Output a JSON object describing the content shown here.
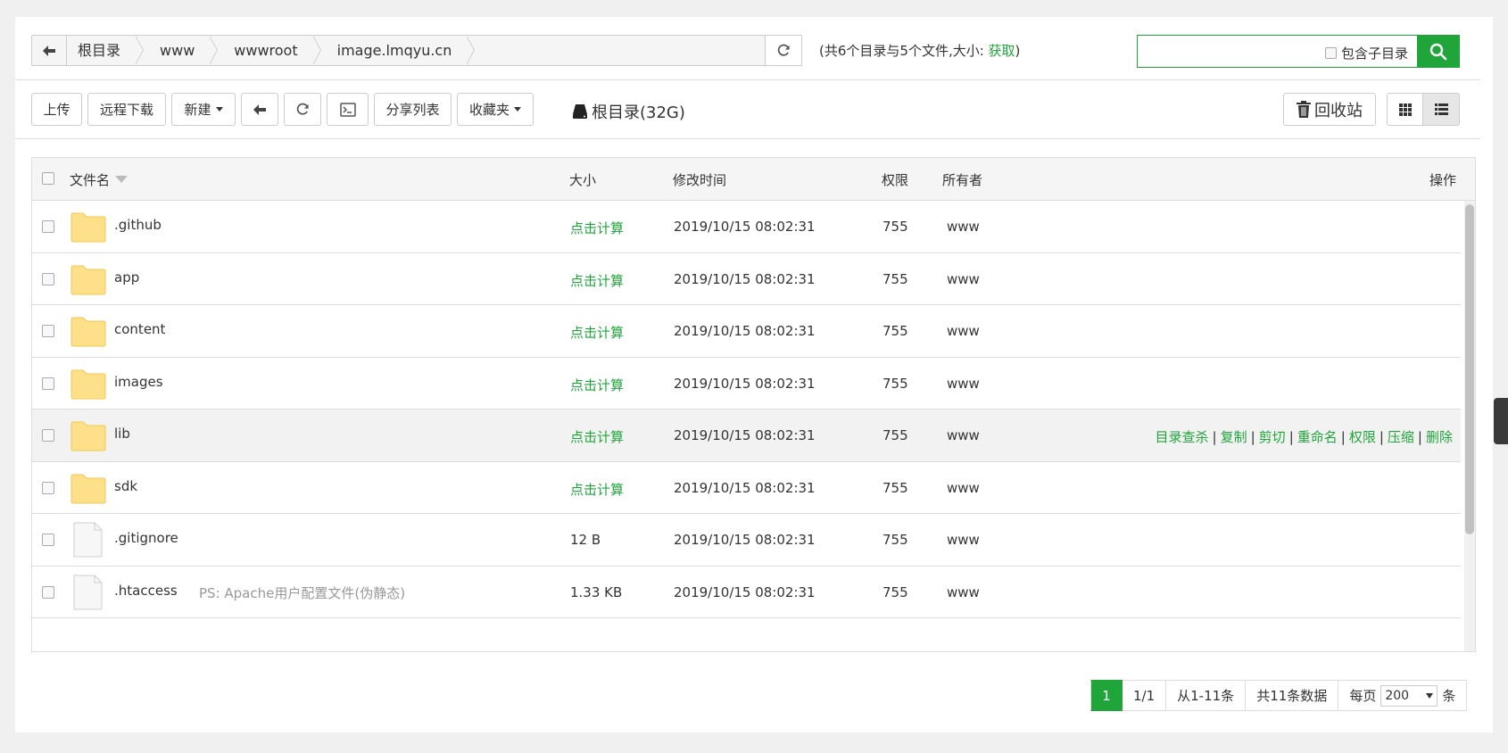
{
  "breadcrumb": [
    "根目录",
    "www",
    "wwwroot",
    "image.lmqyu.cn"
  ],
  "dir_info": {
    "prefix": "(共6个目录与5个文件,大小: ",
    "link": "获取",
    "suffix": ")"
  },
  "search": {
    "value": "",
    "subdir_label": "包含子目录"
  },
  "toolbar": {
    "upload": "上传",
    "remote_download": "远程下载",
    "new": "新建",
    "share_list": "分享列表",
    "favorites": "收藏夹",
    "disk_label": "根目录(32G)",
    "recycle": "回收站"
  },
  "table": {
    "headers": {
      "name": "文件名",
      "size": "大小",
      "mtime": "修改时间",
      "perm": "权限",
      "owner": "所有者",
      "ops": "操作"
    },
    "rows": [
      {
        "type": "folder",
        "name": ".github",
        "size": "点击计算",
        "mtime": "2019/10/15 08:02:31",
        "perm": "755",
        "owner": "www"
      },
      {
        "type": "folder",
        "name": "app",
        "size": "点击计算",
        "mtime": "2019/10/15 08:02:31",
        "perm": "755",
        "owner": "www"
      },
      {
        "type": "folder",
        "name": "content",
        "size": "点击计算",
        "mtime": "2019/10/15 08:02:31",
        "perm": "755",
        "owner": "www"
      },
      {
        "type": "folder",
        "name": "images",
        "size": "点击计算",
        "mtime": "2019/10/15 08:02:31",
        "perm": "755",
        "owner": "www"
      },
      {
        "type": "folder",
        "name": "lib",
        "size": "点击计算",
        "mtime": "2019/10/15 08:02:31",
        "perm": "755",
        "owner": "www",
        "hover": true,
        "ops": [
          "目录查杀",
          "复制",
          "剪切",
          "重命名",
          "权限",
          "压缩",
          "删除"
        ]
      },
      {
        "type": "folder",
        "name": "sdk",
        "size": "点击计算",
        "mtime": "2019/10/15 08:02:31",
        "perm": "755",
        "owner": "www"
      },
      {
        "type": "file",
        "name": ".gitignore",
        "size": "12 B",
        "mtime": "2019/10/15 08:02:31",
        "perm": "755",
        "owner": "www"
      },
      {
        "type": "file",
        "name": ".htaccess",
        "ps": "PS: Apache用户配置文件(伪静态)",
        "size": "1.33 KB",
        "mtime": "2019/10/15 08:02:31",
        "perm": "755",
        "owner": "www"
      }
    ]
  },
  "pagination": {
    "current": "1",
    "pages": "1/1",
    "range": "从1-11条",
    "total_prefix": "共",
    "total_count": "11",
    "total_suffix": "条数据",
    "per_page_label": "每页",
    "per_page_value": "200",
    "per_page_unit": "条"
  },
  "colors": {
    "accent": "#20a53a",
    "folder": "#ffe08a"
  }
}
